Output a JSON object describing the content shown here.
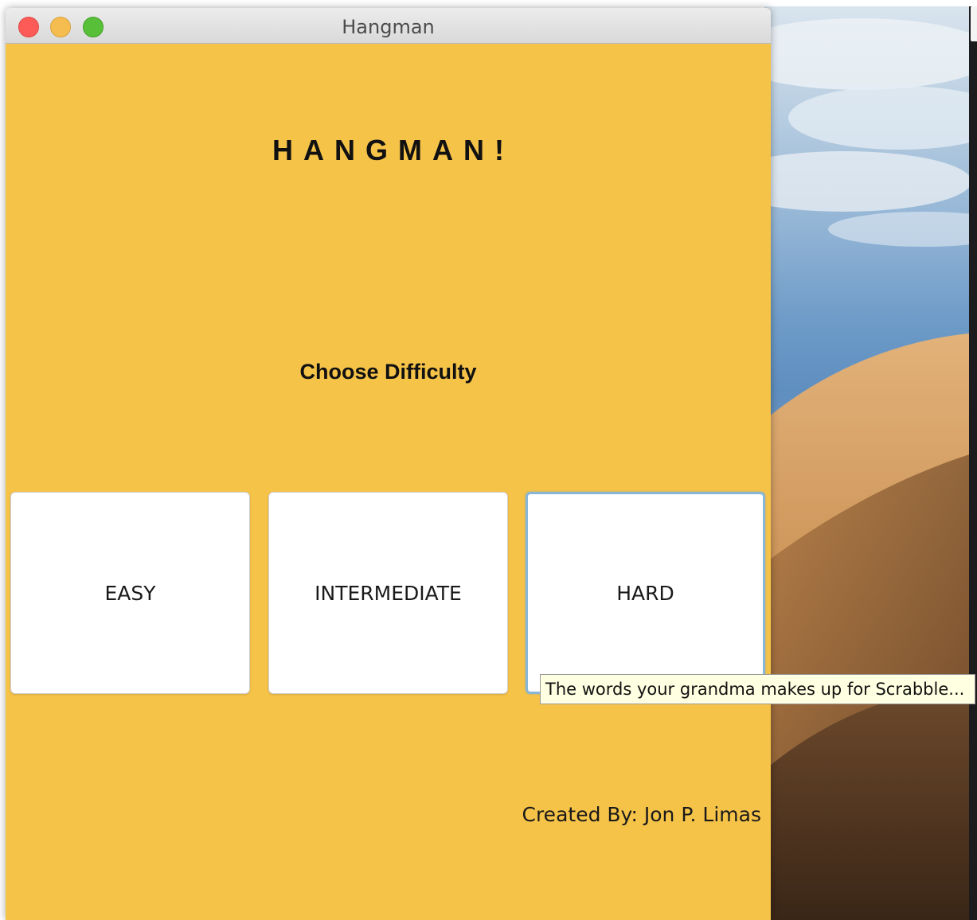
{
  "window": {
    "title": "Hangman"
  },
  "game": {
    "title": "HANGMAN!",
    "subtitle": "Choose Difficulty",
    "buttons": {
      "easy": "EASY",
      "intermediate": "INTERMEDIATE",
      "hard": "HARD"
    },
    "tooltip": "The words your grandma makes up for Scrabble...",
    "credit": "Created By: Jon P. Limas"
  },
  "colors": {
    "window_background": "#f6c349",
    "button_background": "#ffffff",
    "focus_ring": "#87b6d6",
    "tooltip_background": "#ffffe1"
  }
}
